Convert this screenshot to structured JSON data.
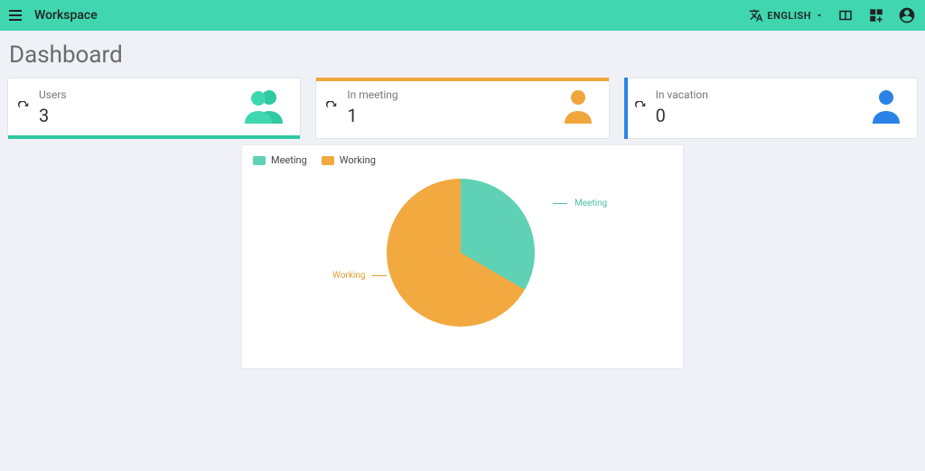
{
  "appbar": {
    "title": "Workspace",
    "language_label": "ENGLISH"
  },
  "page": {
    "title": "Dashboard"
  },
  "cards": {
    "users": {
      "label": "Users",
      "value": "3",
      "accent": "#2fc9a2"
    },
    "meeting": {
      "label": "In meeting",
      "value": "1",
      "accent": "#f0a63a"
    },
    "vacation": {
      "label": "In vacation",
      "value": "0",
      "accent": "#2b82e6"
    }
  },
  "legend": {
    "meeting": "Meeting",
    "working": "Working"
  },
  "chart_data": {
    "type": "pie",
    "title": "",
    "series": [
      {
        "name": "Meeting",
        "value": 1,
        "color": "#5fd1b5"
      },
      {
        "name": "Working",
        "value": 2,
        "color": "#f2a940"
      }
    ],
    "legend_position": "top-left",
    "labels": [
      "Meeting",
      "Working"
    ]
  }
}
